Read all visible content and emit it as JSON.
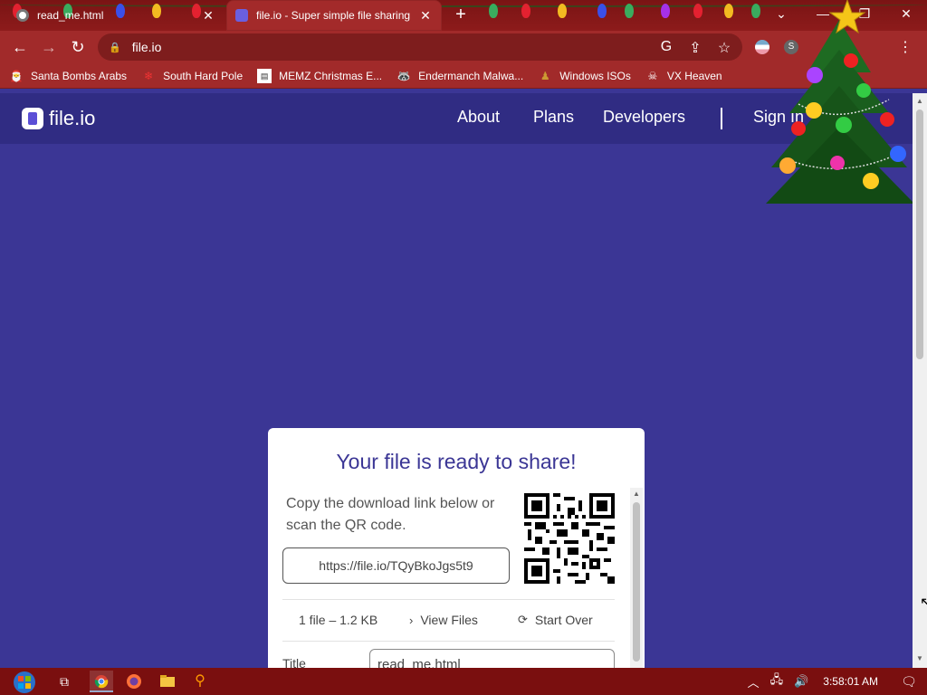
{
  "browser": {
    "tabs": [
      {
        "title": "read_me.html",
        "active": false
      },
      {
        "title": "file.io - Super simple file sharing",
        "active": true
      }
    ],
    "new_tab": "+",
    "controls": {
      "list": "⌄",
      "minimize": "—",
      "restore": "❐",
      "close": "✕"
    },
    "nav": {
      "back": "←",
      "forward": "→",
      "reload": "↻"
    },
    "address": "file.io",
    "bookmarks": [
      {
        "label": "Santa Bombs Arabs",
        "icon": "santa-icon"
      },
      {
        "label": "South Hard Pole",
        "icon": "snowflake-icon"
      },
      {
        "label": "MEMZ Christmas E...",
        "icon": "page-icon"
      },
      {
        "label": "Endermanch Malwa...",
        "icon": "raccoon-icon"
      },
      {
        "label": "Windows ISOs",
        "icon": "folder-icon"
      },
      {
        "label": "VX Heaven",
        "icon": "skull-icon"
      }
    ]
  },
  "site": {
    "logo_text": "file.io",
    "nav": {
      "about": "About",
      "plans": "Plans",
      "developers": "Developers",
      "sign_in": "Sign In"
    }
  },
  "card": {
    "title": "Your file is ready to share!",
    "description": "Copy the download link below or scan the QR code.",
    "link": "https://file.io/TQyBkoJgs5t9",
    "file_count": "1 file – 1.2 KB",
    "view_files": "View Files",
    "start_over": "Start Over",
    "title_label": "Title",
    "title_value": "read_me.html"
  },
  "taskbar": {
    "clock": "3:58:01 AM",
    "icons": [
      "task-view-icon",
      "chrome-icon",
      "firefox-icon",
      "file-explorer-icon",
      "search-icon"
    ]
  },
  "colors": {
    "page_bg": "#3b3695",
    "nav_bg": "#302c83",
    "chrome_red": "#a12a2a",
    "accent": "#3b3695"
  }
}
